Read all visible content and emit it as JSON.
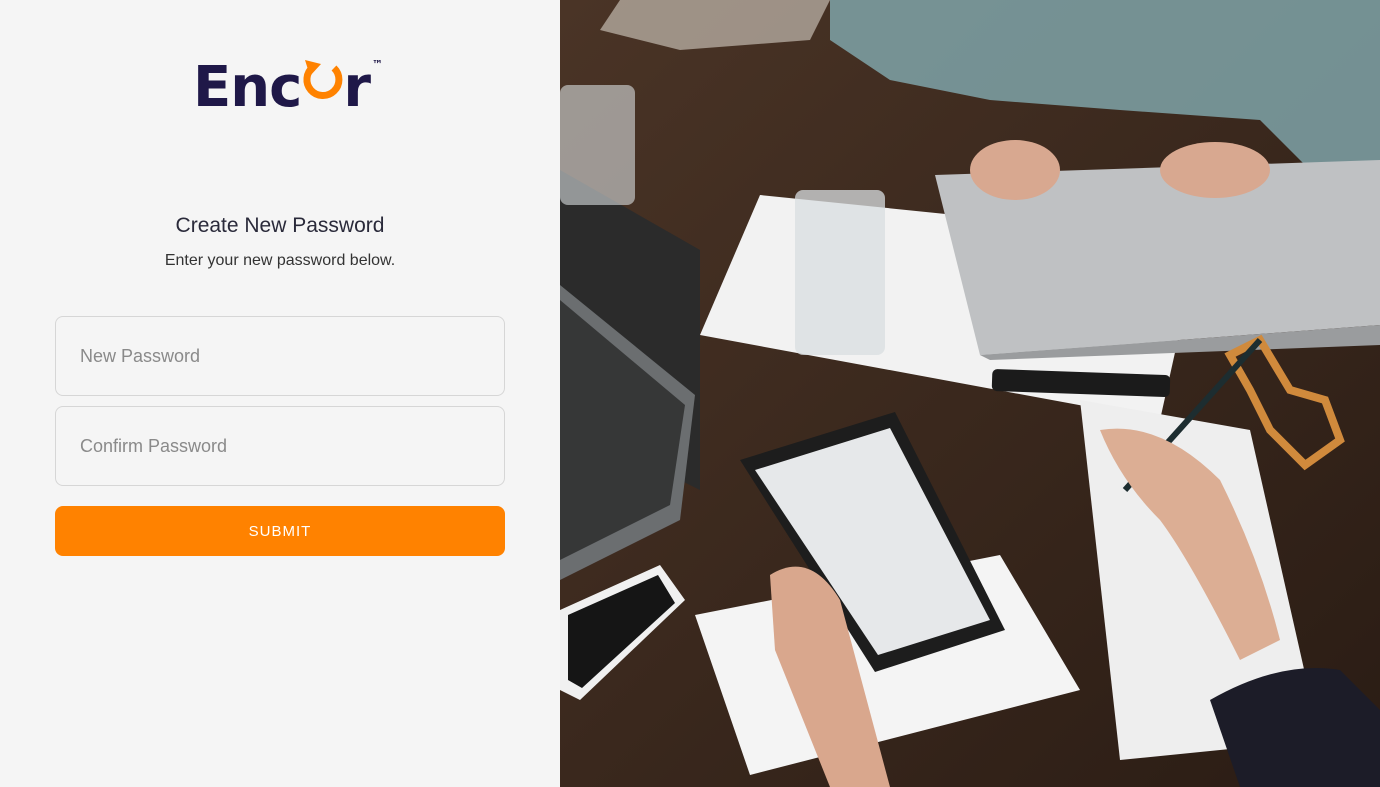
{
  "brand": {
    "name_prefix": "Enc",
    "name_suffix": "r",
    "trademark": "™",
    "accent_color": "#ff8200",
    "text_color": "#1f1848"
  },
  "form": {
    "title": "Create New Password",
    "subtitle": "Enter your new password below.",
    "new_password_placeholder": "New Password",
    "confirm_password_placeholder": "Confirm Password",
    "submit_label": "SUBMIT"
  },
  "hero_image": {
    "icon": "workspace-photo"
  }
}
